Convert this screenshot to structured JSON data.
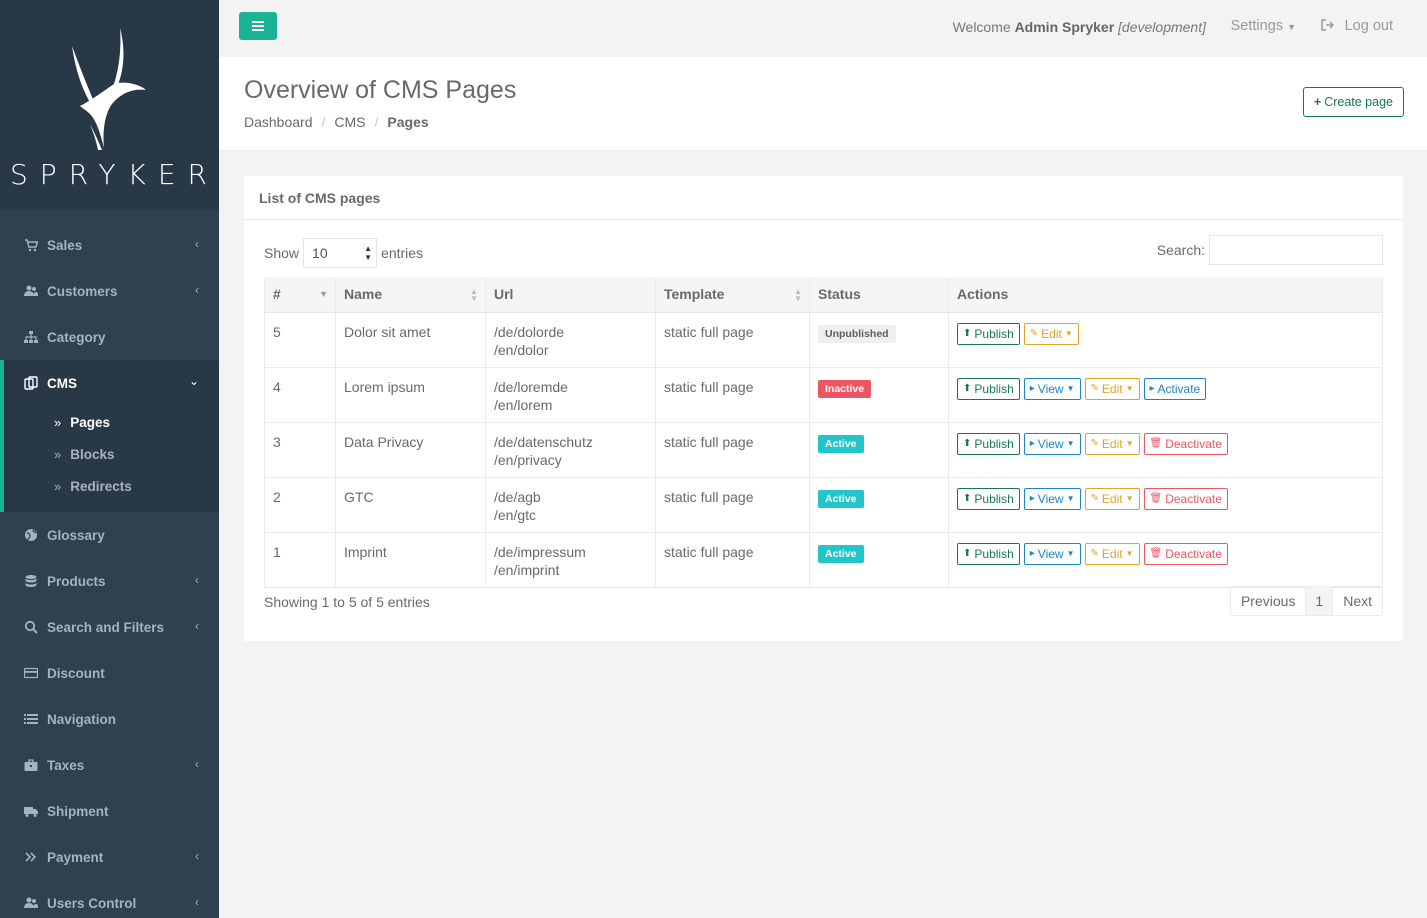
{
  "brand": {
    "name": "SPRYKER"
  },
  "sidebar": {
    "items": [
      {
        "label": "Sales",
        "icon": "cart-icon",
        "chevron": "‹"
      },
      {
        "label": "Customers",
        "icon": "users-icon",
        "chevron": "‹"
      },
      {
        "label": "Category",
        "icon": "sitemap-icon",
        "chevron": ""
      },
      {
        "label": "CMS",
        "icon": "files-icon",
        "chevron": "⌄"
      },
      {
        "label": "Glossary",
        "icon": "globe-icon",
        "chevron": ""
      },
      {
        "label": "Products",
        "icon": "database-icon",
        "chevron": "‹"
      },
      {
        "label": "Search and Filters",
        "icon": "search-icon",
        "chevron": "‹"
      },
      {
        "label": "Discount",
        "icon": "credit-card-icon",
        "chevron": ""
      },
      {
        "label": "Navigation",
        "icon": "list-icon",
        "chevron": ""
      },
      {
        "label": "Taxes",
        "icon": "briefcase-icon",
        "chevron": "‹"
      },
      {
        "label": "Shipment",
        "icon": "truck-icon",
        "chevron": ""
      },
      {
        "label": "Payment",
        "icon": "angle-double-right-icon",
        "chevron": "‹"
      },
      {
        "label": "Users Control",
        "icon": "users-icon",
        "chevron": "‹"
      }
    ],
    "cms_sub": [
      {
        "label": "Pages",
        "active": true
      },
      {
        "label": "Blocks",
        "active": false
      },
      {
        "label": "Redirects",
        "active": false
      }
    ]
  },
  "topbar": {
    "welcome_prefix": "Welcome",
    "user": "Admin Spryker",
    "env": "[development]",
    "settings": "Settings",
    "logout": "Log out"
  },
  "heading": {
    "title": "Overview of CMS Pages",
    "breadcrumb": [
      "Dashboard",
      "CMS",
      "Pages"
    ],
    "create_label": "Create page"
  },
  "panel": {
    "title": "List of CMS pages",
    "show_label": "Show",
    "entries_label": "entries",
    "page_size": "10",
    "search_label": "Search:",
    "search_value": "",
    "columns": [
      "#",
      "Name",
      "Url",
      "Template",
      "Status",
      "Actions"
    ],
    "rows": [
      {
        "id": "5",
        "name": "Dolor sit amet",
        "urls": [
          "/de/dolorde",
          "/en/dolor"
        ],
        "template": "static full page",
        "status": "Unpublished",
        "status_kind": "unpub",
        "actions": [
          "Publish",
          "Edit"
        ]
      },
      {
        "id": "4",
        "name": "Lorem ipsum",
        "urls": [
          "/de/loremde",
          "/en/lorem"
        ],
        "template": "static full page",
        "status": "Inactive",
        "status_kind": "inactive",
        "actions": [
          "Publish",
          "View",
          "Edit",
          "Activate"
        ]
      },
      {
        "id": "3",
        "name": "Data Privacy",
        "urls": [
          "/de/datenschutz",
          "/en/privacy"
        ],
        "template": "static full page",
        "status": "Active",
        "status_kind": "active",
        "actions": [
          "Publish",
          "View",
          "Edit",
          "Deactivate"
        ]
      },
      {
        "id": "2",
        "name": "GTC",
        "urls": [
          "/de/agb",
          "/en/gtc"
        ],
        "template": "static full page",
        "status": "Active",
        "status_kind": "active",
        "actions": [
          "Publish",
          "View",
          "Edit",
          "Deactivate"
        ]
      },
      {
        "id": "1",
        "name": "Imprint",
        "urls": [
          "/de/impressum",
          "/en/imprint"
        ],
        "template": "static full page",
        "status": "Active",
        "status_kind": "active",
        "actions": [
          "Publish",
          "View",
          "Edit",
          "Deactivate"
        ]
      }
    ],
    "showing": "Showing 1 to 5 of 5 entries",
    "pager": {
      "previous": "Previous",
      "current": "1",
      "next": "Next"
    }
  },
  "colors": {
    "sidebar": "#2f4050",
    "accent": "#1ab394",
    "success": "#18794e",
    "info": "#1c84c6",
    "warning": "#e2a326",
    "danger": "#ed5565",
    "active_badge": "#23c6c8"
  }
}
